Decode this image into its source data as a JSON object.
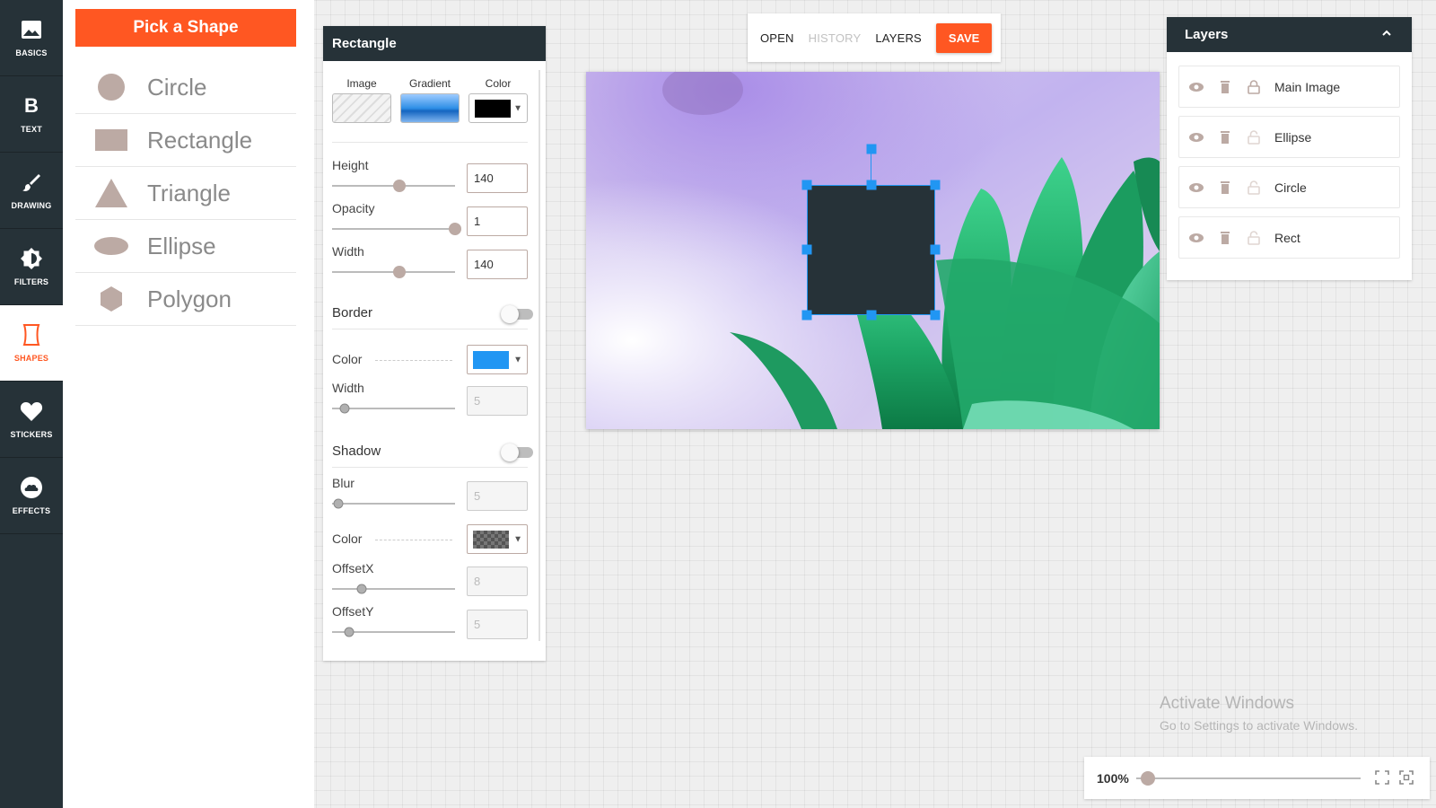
{
  "nav": {
    "items": [
      {
        "label": "BASICS",
        "icon": "image-icon"
      },
      {
        "label": "TEXT",
        "icon": "bold-b-icon"
      },
      {
        "label": "DRAWING",
        "icon": "brush-icon"
      },
      {
        "label": "FILTERS",
        "icon": "brightness-icon"
      },
      {
        "label": "SHAPES",
        "icon": "shapes-icon",
        "active": true
      },
      {
        "label": "STICKERS",
        "icon": "heart-icon"
      },
      {
        "label": "EFFECTS",
        "icon": "cloud-icon"
      }
    ]
  },
  "picker": {
    "button_label": "Pick a Shape",
    "shapes": [
      {
        "name": "Circle",
        "icon": "circle-icon"
      },
      {
        "name": "Rectangle",
        "icon": "rectangle-icon"
      },
      {
        "name": "Triangle",
        "icon": "triangle-icon"
      },
      {
        "name": "Ellipse",
        "icon": "ellipse-icon"
      },
      {
        "name": "Polygon",
        "icon": "polygon-icon"
      }
    ]
  },
  "props": {
    "title": "Rectangle",
    "fill": {
      "image_label": "Image",
      "gradient_label": "Gradient",
      "color_label": "Color",
      "color_value": "#000000"
    },
    "height": {
      "label": "Height",
      "value": "140",
      "slider": 0.55
    },
    "opacity": {
      "label": "Opacity",
      "value": "1",
      "slider": 1.0
    },
    "width": {
      "label": "Width",
      "value": "140",
      "slider": 0.55
    },
    "border": {
      "title": "Border",
      "enabled": false,
      "color_label": "Color",
      "color_value": "#2196f3",
      "width_label": "Width",
      "width_value": "5",
      "width_slider": 0.1
    },
    "shadow": {
      "title": "Shadow",
      "enabled": false,
      "blur_label": "Blur",
      "blur_value": "5",
      "blur_slider": 0.05,
      "color_label": "Color",
      "color_value": "transparent",
      "offsetx_label": "OffsetX",
      "offsetx_value": "8",
      "offsetx_slider": 0.24,
      "offsety_label": "OffsetY",
      "offsety_value": "5",
      "offsety_slider": 0.14
    }
  },
  "toolbar": {
    "open": "OPEN",
    "history": "HISTORY",
    "layers": "LAYERS",
    "save": "SAVE"
  },
  "layers": {
    "title": "Layers",
    "items": [
      {
        "name": "Main Image",
        "locked": true
      },
      {
        "name": "Ellipse",
        "locked": false
      },
      {
        "name": "Circle",
        "locked": false
      },
      {
        "name": "Rect",
        "locked": false
      }
    ]
  },
  "watermark": {
    "title": "Activate Windows",
    "subtitle": "Go to Settings to activate Windows."
  },
  "zoom": {
    "label": "100%",
    "level": 0.05
  },
  "colors": {
    "accent": "#ff5722",
    "dark": "#263238",
    "selection": "#2196f3",
    "shape_fill": "#bcaaa4"
  }
}
